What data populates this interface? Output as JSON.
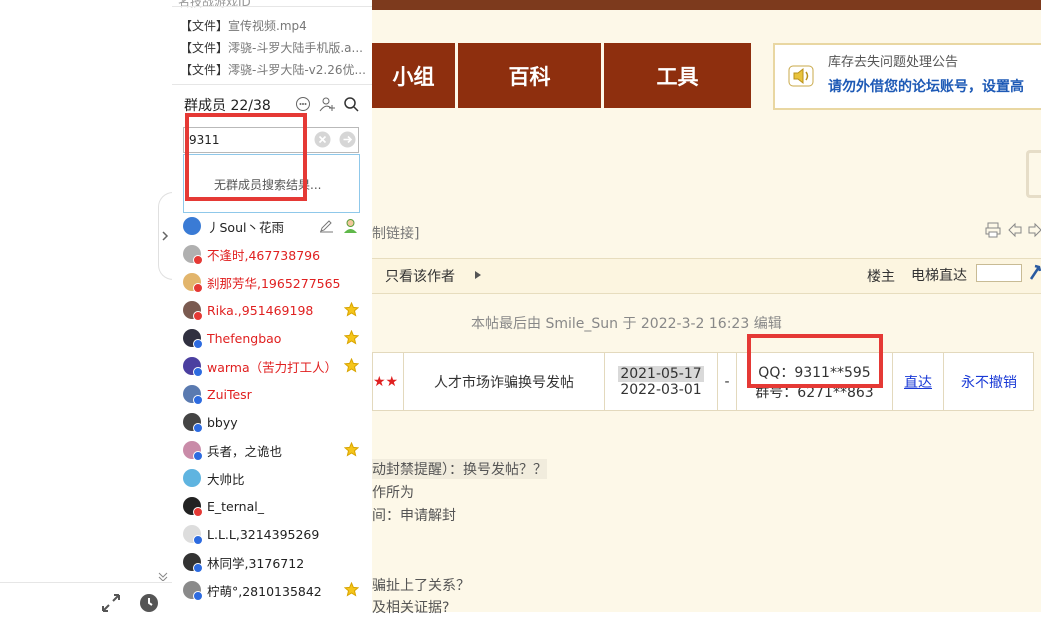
{
  "group_panel": {
    "header_cut_text": "名技战游戏ID",
    "files": [
      {
        "tag": "【文件】",
        "name": "宣传视频.mp4"
      },
      {
        "tag": "【文件】",
        "name": "澪骁-斗罗大陆手机版.a..."
      },
      {
        "tag": "【文件】",
        "name": "澪骁-斗罗大陆-v2.26优..."
      }
    ],
    "members_title": "群成员 22/38",
    "search_value": "9311",
    "no_result_text": "无群成员搜索结果...",
    "members": [
      {
        "name": "丿Soul丶花雨",
        "color": "#222222",
        "avatar_color": "#3a7bd5",
        "badge": "edit-person"
      },
      {
        "name": "不逢时,467738796",
        "color": "#e02020",
        "avatar_color": "#b0b0b0",
        "badge": ""
      },
      {
        "name": "刹那芳华,1965277565",
        "color": "#e02020",
        "avatar_color": "#e2b56c",
        "badge": ""
      },
      {
        "name": "Rika.,951469198",
        "color": "#e02020",
        "avatar_color": "#7a5a50",
        "badge": "star"
      },
      {
        "name": "Thefengbao",
        "color": "#e02020",
        "avatar_color": "#303040",
        "badge": "star"
      },
      {
        "name": "warma（苦力打工人）",
        "color": "#e02020",
        "avatar_color": "#4b3fa0",
        "badge": "star"
      },
      {
        "name": "ZuiTesr",
        "color": "#e02020",
        "avatar_color": "#5a7ab0",
        "badge": ""
      },
      {
        "name": "bbyy",
        "color": "#222222",
        "avatar_color": "#444444",
        "badge": ""
      },
      {
        "name": "兵者，之诡也",
        "color": "#222222",
        "avatar_color": "#c98ba8",
        "badge": "star"
      },
      {
        "name": "大帅比",
        "color": "#222222",
        "avatar_color": "#5fb4e0",
        "badge": ""
      },
      {
        "name": "E_ternal_",
        "color": "#222222",
        "avatar_color": "#222222",
        "badge": ""
      },
      {
        "name": "L.L.L,3214395269",
        "color": "#222222",
        "avatar_color": "#dddddd",
        "badge": ""
      },
      {
        "name": "林同学,3176712",
        "color": "#222222",
        "avatar_color": "#333333",
        "badge": ""
      },
      {
        "name": "柠萌°,2810135842",
        "color": "#222222",
        "avatar_color": "#8a8a8a",
        "badge": "star"
      }
    ]
  },
  "forum": {
    "nav": [
      "小组",
      "百科",
      "工具"
    ],
    "notice_title": "库存去失问题处理公告",
    "notice_text": "请勿外借您的论坛账号，设置高",
    "copy_link": "制链接]",
    "only_author": "只看该作者",
    "floor_label": "楼主",
    "elevator_label": "电梯直达",
    "last_edit": "本帖最后由 Smile_Sun 于 2022-3-2 16:23 编辑",
    "row": {
      "stars": "★★",
      "title": "人才市场诈骗换号发帖",
      "date1": "2021-05-17",
      "date2": "2022-03-01",
      "dash": "-",
      "qq": "QQ：9311**595",
      "group": "群号：6271**863",
      "link": "直达",
      "ban": "永不撤销"
    },
    "body_lines": [
      "动封禁提醒）：换号发帖？？",
      "作所为",
      "间：申请解封",
      "骗扯上了关系？",
      "及相关证据?"
    ]
  }
}
